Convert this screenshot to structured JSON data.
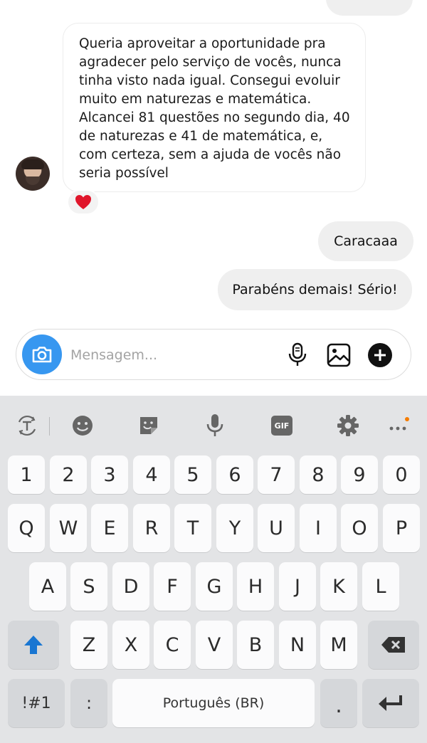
{
  "chat": {
    "incoming_message": {
      "text": "Queria aproveitar a oportunidade pra agradecer pelo serviço de vocês, nunca tinha visto nada igual. Consegui evoluir muito em naturezas e matemática. Alcancei 81 questões no segundo dia, 40 de naturezas e 41 de matemática, e, com certeza, sem a ajuda de vocês não seria possível",
      "reaction": "heart"
    },
    "outgoing_messages": [
      "Caracaaa",
      "Parabéns demais! Sério!"
    ]
  },
  "composer": {
    "placeholder": "Mensagem...",
    "value": ""
  },
  "keyboard": {
    "toolbar": [
      "translate-icon",
      "emoji-icon",
      "sticker-icon",
      "mic-icon",
      "gif-icon",
      "settings-icon",
      "more-icon"
    ],
    "gif_label": "GIF",
    "row_numbers": [
      "1",
      "2",
      "3",
      "4",
      "5",
      "6",
      "7",
      "8",
      "9",
      "0"
    ],
    "row_top": [
      "Q",
      "W",
      "E",
      "R",
      "T",
      "Y",
      "U",
      "I",
      "O",
      "P"
    ],
    "row_middle": [
      "A",
      "S",
      "D",
      "F",
      "G",
      "H",
      "J",
      "K",
      "L"
    ],
    "row_bottom": [
      "Z",
      "X",
      "C",
      "V",
      "B",
      "N",
      "M"
    ],
    "symbols_label": "!#1",
    "colon_label": ":",
    "space_label": "Português (BR)",
    "period_label": ".",
    "colors": {
      "accent": "#3797f0",
      "shift": "#1976d2",
      "heart": "#e0162b"
    }
  }
}
